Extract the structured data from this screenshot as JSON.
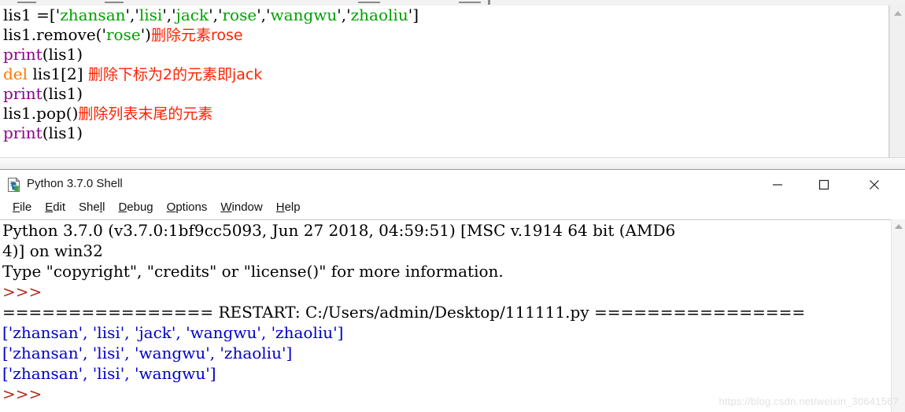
{
  "editor": {
    "name": "idle-editor-pane",
    "code_lines": [
      {
        "id": "line-1",
        "segments": [
          {
            "kind": "plain",
            "text": "lis1 =['"
          },
          {
            "kind": "string",
            "text": "zhansan"
          },
          {
            "kind": "plain",
            "text": "','"
          },
          {
            "kind": "string",
            "text": "lisi"
          },
          {
            "kind": "plain",
            "text": "','"
          },
          {
            "kind": "string",
            "text": "jack"
          },
          {
            "kind": "plain",
            "text": "','"
          },
          {
            "kind": "string",
            "text": "rose"
          },
          {
            "kind": "plain",
            "text": "','"
          },
          {
            "kind": "string",
            "text": "wangwu"
          },
          {
            "kind": "plain",
            "text": "','"
          },
          {
            "kind": "string",
            "text": "zhaoliu"
          },
          {
            "kind": "plain",
            "text": "']"
          }
        ],
        "plain_text": "lis1 =['zhansan','lisi','jack','rose','wangwu','zhaoliu']"
      },
      {
        "id": "line-2",
        "segments": [
          {
            "kind": "plain",
            "text": "lis1.remove('"
          },
          {
            "kind": "string",
            "text": "rose"
          },
          {
            "kind": "plain",
            "text": "')"
          },
          {
            "kind": "comment_cn",
            "text": "删除元素rose"
          }
        ],
        "plain_text": "lis1.remove('rose')删除元素rose"
      },
      {
        "id": "line-3",
        "segments": [
          {
            "kind": "builtin",
            "text": "print"
          },
          {
            "kind": "plain",
            "text": "(lis1)"
          }
        ],
        "plain_text": "print(lis1)"
      },
      {
        "id": "line-4",
        "segments": [
          {
            "kind": "keyword",
            "text": "del"
          },
          {
            "kind": "plain",
            "text": " lis1[2] "
          },
          {
            "kind": "comment_cn",
            "text": "删除下标为2的元素即jack"
          }
        ],
        "plain_text": "del lis1[2] 删除下标为2的元素即jack"
      },
      {
        "id": "line-5",
        "segments": [
          {
            "kind": "builtin",
            "text": "print"
          },
          {
            "kind": "plain",
            "text": "(lis1)"
          }
        ],
        "plain_text": "print(lis1)"
      },
      {
        "id": "line-6",
        "segments": [
          {
            "kind": "plain",
            "text": "lis1.pop()"
          },
          {
            "kind": "comment_cn",
            "text": "删除列表末尾的元素"
          }
        ],
        "plain_text": "lis1.pop()删除列表末尾的元素"
      },
      {
        "id": "line-7",
        "segments": [
          {
            "kind": "builtin",
            "text": "print"
          },
          {
            "kind": "plain",
            "text": "(lis1)"
          }
        ],
        "plain_text": "print(lis1)"
      }
    ],
    "syntax_colors": {
      "plain": "#000000",
      "string": "#00a000",
      "builtin": "#900090",
      "keyword": "#ff7700",
      "comment_cn": "#ff2200"
    }
  },
  "shell": {
    "title": "Python 3.7.0 Shell",
    "title_icon": "python-file-icon",
    "window_controls": [
      {
        "name": "minimize-button",
        "glyph": "minimize-icon"
      },
      {
        "name": "maximize-button",
        "glyph": "maximize-icon"
      },
      {
        "name": "close-button",
        "glyph": "close-icon"
      }
    ],
    "menu": [
      {
        "label": "File",
        "mnemonic_index": 0
      },
      {
        "label": "Edit",
        "mnemonic_index": 0
      },
      {
        "label": "Shell",
        "mnemonic_index": 3
      },
      {
        "label": "Debug",
        "mnemonic_index": 0
      },
      {
        "label": "Options",
        "mnemonic_index": 0
      },
      {
        "label": "Window",
        "mnemonic_index": 0
      },
      {
        "label": "Help",
        "mnemonic_index": 0
      }
    ],
    "output_lines": [
      {
        "id": "banner-1",
        "kind": "plain",
        "text": "Python 3.7.0 (v3.7.0:1bf9cc5093, Jun 27 2018, 04:59:51) [MSC v.1914 64 bit (AMD6"
      },
      {
        "id": "banner-2",
        "kind": "plain",
        "text": "4)] on win32"
      },
      {
        "id": "banner-3",
        "kind": "plain",
        "text": "Type \"copyright\", \"credits\" or \"license()\" for more information."
      },
      {
        "id": "prompt-1",
        "kind": "prompt",
        "text": ">>>"
      },
      {
        "id": "restart-1",
        "kind": "restart",
        "text": "================ RESTART: C:/Users/admin/Desktop/111111.py ================"
      },
      {
        "id": "out-1",
        "kind": "output",
        "text": "['zhansan', 'lisi', 'jack', 'wangwu', 'zhaoliu']"
      },
      {
        "id": "out-2",
        "kind": "output",
        "text": "['zhansan', 'lisi', 'wangwu', 'zhaoliu']"
      },
      {
        "id": "out-3",
        "kind": "output",
        "text": "['zhansan', 'lisi', 'wangwu']"
      },
      {
        "id": "prompt-2",
        "kind": "prompt",
        "text": ">>>"
      }
    ],
    "colors": {
      "prompt": "#b03020",
      "output": "#0000cc",
      "plain": "#000000"
    },
    "restart_file_path": "C:/Users/admin/Desktop/111111.py"
  },
  "watermark": {
    "text": "https://blog.csdn.net/weixin_30641567"
  }
}
